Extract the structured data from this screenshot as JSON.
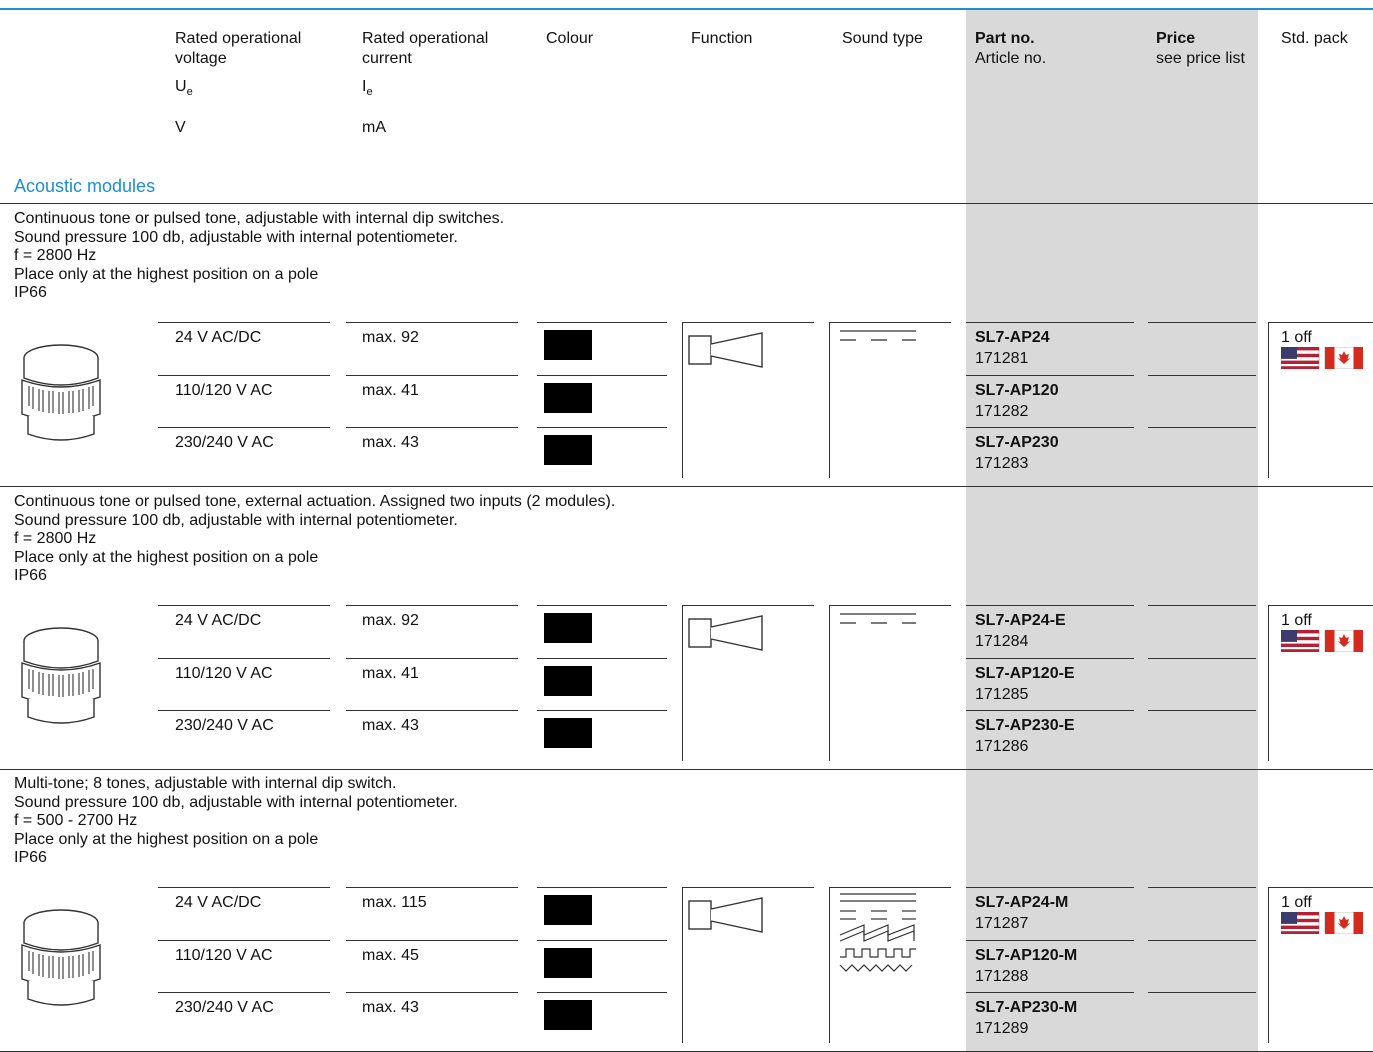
{
  "header": {
    "voltage": {
      "line1": "Rated operational",
      "line2": "voltage",
      "symbol": "U",
      "subscript": "e",
      "unit": "V"
    },
    "current": {
      "line1": "Rated operational",
      "line2": "current",
      "symbol": "I",
      "subscript": "e",
      "unit": "mA"
    },
    "colour": "Colour",
    "function": "Function",
    "sound_type": "Sound type",
    "part_no": "Part no.",
    "article_no": "Article no.",
    "price": "Price",
    "price_note": "see price list",
    "std_pack": "Std. pack"
  },
  "section_title": "Acoustic modules",
  "groups": [
    {
      "desc": [
        "Continuous tone or pulsed tone, adjustable with internal dip switches.",
        "Sound pressure 100 db, adjustable with internal potentiometer.",
        "f = 2800 Hz",
        "Place only at the highest position on a pole",
        "IP66"
      ],
      "pack": "1 off",
      "sound_icon": "continuous-pulsed-tone-icon",
      "rows": [
        {
          "voltage": "24 V AC/DC",
          "current": "max. 92",
          "part": "SL7-AP24",
          "article": "171281"
        },
        {
          "voltage": "110/120 V AC",
          "current": "max. 41",
          "part": "SL7-AP120",
          "article": "171282"
        },
        {
          "voltage": "230/240 V AC",
          "current": "max. 43",
          "part": "SL7-AP230",
          "article": "171283"
        }
      ]
    },
    {
      "desc": [
        "Continuous tone or pulsed tone, external actuation. Assigned two inputs (2 modules).",
        "Sound pressure 100 db, adjustable with internal potentiometer.",
        "f = 2800 Hz",
        "Place only at the highest position on a pole",
        "IP66"
      ],
      "pack": "1 off",
      "sound_icon": "continuous-pulsed-tone-icon",
      "rows": [
        {
          "voltage": "24 V AC/DC",
          "current": "max. 92",
          "part": "SL7-AP24-E",
          "article": "171284"
        },
        {
          "voltage": "110/120 V AC",
          "current": "max. 41",
          "part": "SL7-AP120-E",
          "article": "171285"
        },
        {
          "voltage": "230/240 V AC",
          "current": "max. 43",
          "part": "SL7-AP230-E",
          "article": "171286"
        }
      ]
    },
    {
      "desc": [
        "Multi-tone; 8 tones, adjustable with internal dip switch.",
        "Sound pressure 100 db, adjustable with internal potentiometer.",
        "f = 500 - 2700 Hz",
        "Place only at the highest position on a pole",
        "IP66"
      ],
      "pack": "1 off",
      "sound_icon": "multi-tone-icon",
      "rows": [
        {
          "voltage": "24 V AC/DC",
          "current": "max. 115",
          "part": "SL7-AP24-M",
          "article": "171287"
        },
        {
          "voltage": "110/120 V AC",
          "current": "max. 45",
          "part": "SL7-AP120-M",
          "article": "171288"
        },
        {
          "voltage": "230/240 V AC",
          "current": "max. 43",
          "part": "SL7-AP230-M",
          "article": "171289"
        }
      ]
    }
  ],
  "colors": {
    "accent": "#1b8fd1",
    "band": "#d9d9d9",
    "swatch": "#000000"
  }
}
